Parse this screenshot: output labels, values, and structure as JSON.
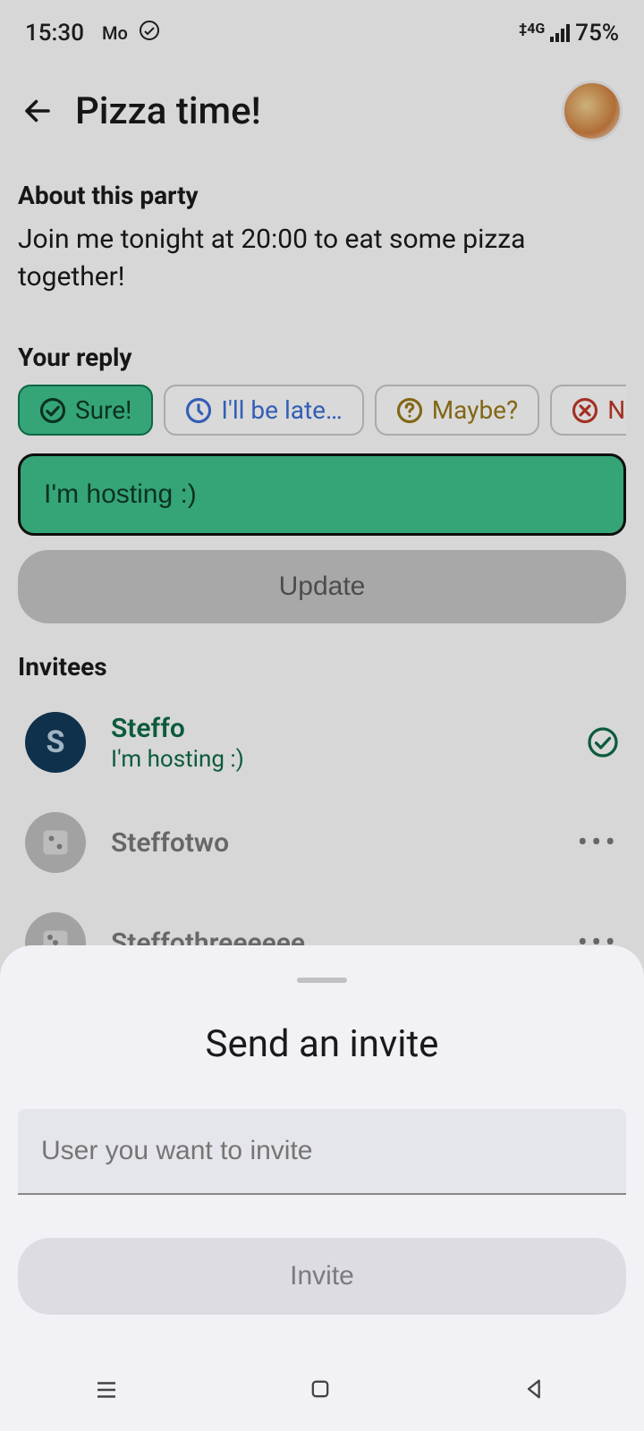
{
  "status": {
    "time": "15:30",
    "battery": "75%",
    "network_type": "4G"
  },
  "header": {
    "title": "Pizza time!"
  },
  "about": {
    "heading": "About this party",
    "text": "Join me tonight at 20:00 to eat some pizza together!"
  },
  "reply": {
    "heading": "Your reply",
    "chips": {
      "sure": "Sure!",
      "late": "I'll be late…",
      "maybe": "Maybe?",
      "no": "No"
    },
    "input_value": "I'm hosting :)",
    "update_label": "Update"
  },
  "invitees": {
    "heading": "Invitees",
    "list": [
      {
        "name": "Steffo",
        "message": "I'm hosting :)",
        "avatar_letter": "S",
        "status": "confirmed"
      },
      {
        "name": "Steffotwo",
        "message": "",
        "avatar_letter": "",
        "status": "pending"
      },
      {
        "name": "Steffothreeeeee",
        "message": "",
        "avatar_letter": "",
        "status": "pending"
      }
    ]
  },
  "sheet": {
    "title": "Send an invite",
    "input_placeholder": "User you want to invite",
    "button_label": "Invite"
  }
}
